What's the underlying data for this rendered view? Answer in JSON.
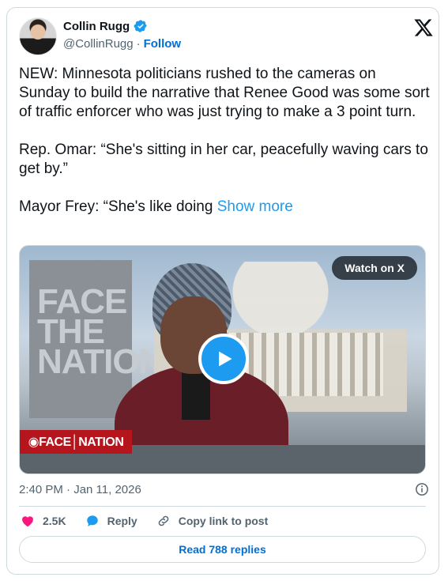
{
  "author": {
    "name": "Collin Rugg",
    "handle": "@CollinRugg",
    "separator": "·",
    "follow_label": "Follow"
  },
  "post": {
    "paragraphs": [
      "NEW: Minnesota politicians rushed to the cameras on Sunday to build the narrative that Renee Good was some sort of traffic enforcer who was just trying to make a 3 point turn.",
      "Rep. Omar: “She's sitting in her car, peacefully waving cars to get by.”"
    ],
    "truncated_start": "Mayor Frey: “She's like doing",
    "show_more_label": "Show more"
  },
  "media": {
    "watch_label": "Watch on X",
    "sign_text": "FACE THE NATION",
    "lower_third": "◉FACE│NATION"
  },
  "meta": {
    "timestamp": "2:40 PM · Jan 11, 2026"
  },
  "actions": {
    "likes": "2.5K",
    "reply_label": "Reply",
    "copy_label": "Copy link to post"
  },
  "replies_button": "Read 788 replies",
  "colors": {
    "accent": "#1d9bf0",
    "follow": "#006fd6",
    "like": "#f91880",
    "border": "#cfd9de",
    "muted": "#536471"
  },
  "icons": [
    "verified-badge-icon",
    "x-logo-icon",
    "play-icon",
    "info-icon",
    "heart-icon",
    "reply-bubble-icon",
    "link-icon"
  ]
}
